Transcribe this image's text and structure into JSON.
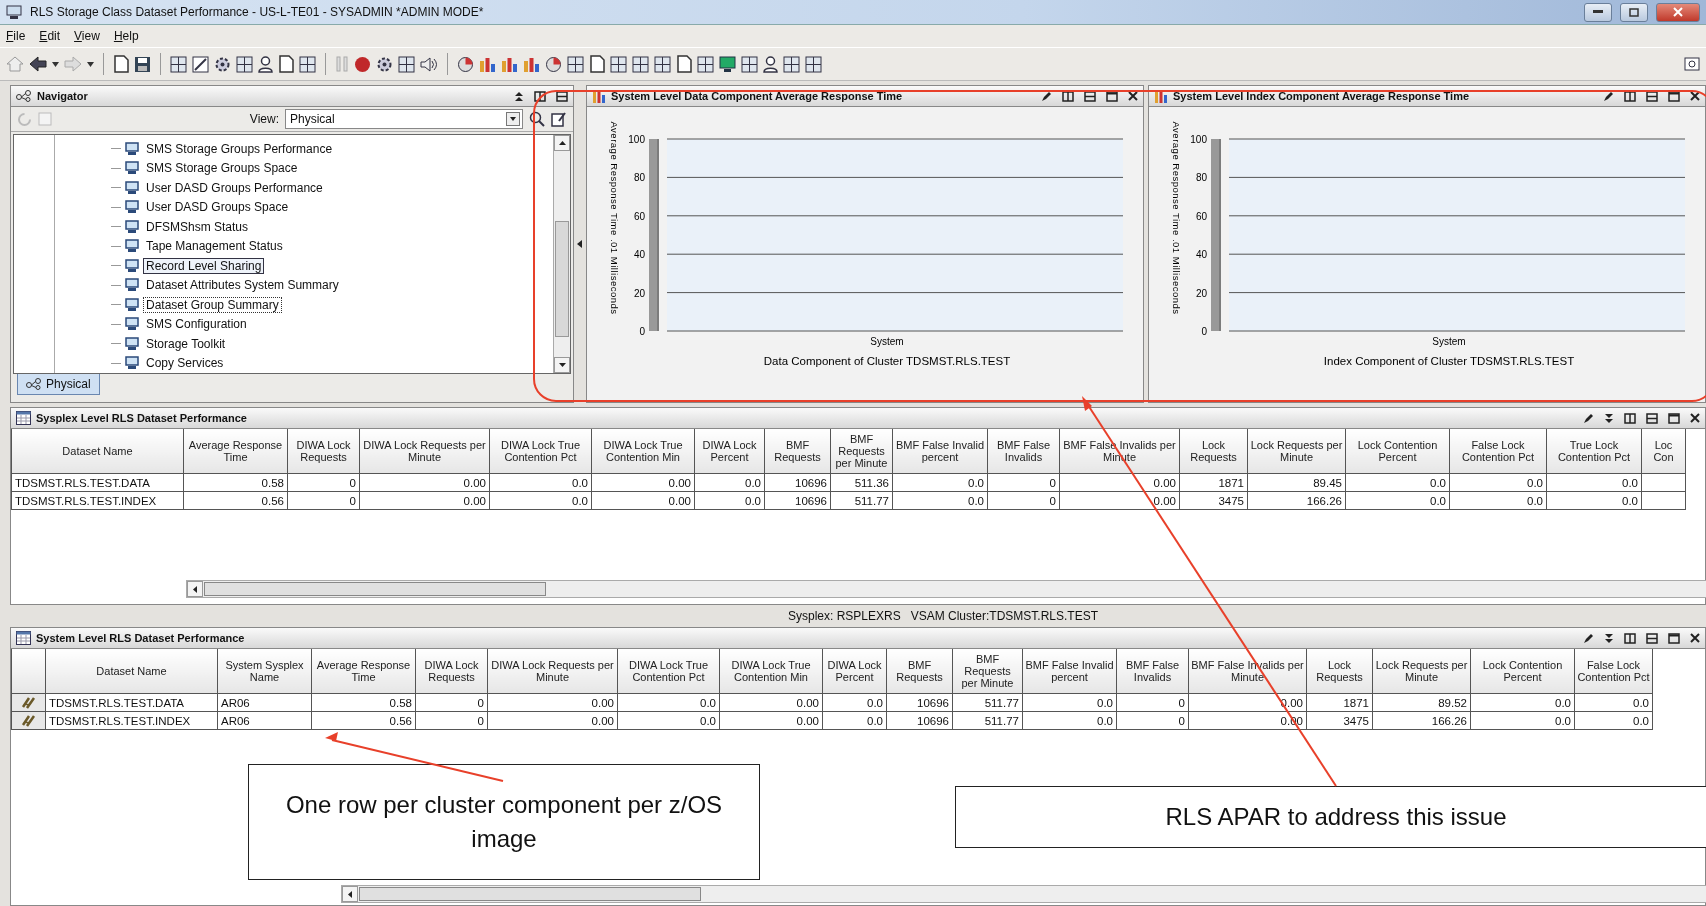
{
  "window": {
    "title": "RLS Storage Class Dataset Performance - US-L-TE01 - SYSADMIN   *ADMIN MODE*"
  },
  "menu": [
    "File",
    "Edit",
    "View",
    "Help"
  ],
  "navigator": {
    "title": "Navigator",
    "view_label": "View:",
    "view_value": "Physical",
    "items": [
      {
        "label": "SMS Storage Groups Performance",
        "selected": false,
        "focused": false
      },
      {
        "label": "SMS Storage Groups Space",
        "selected": false,
        "focused": false
      },
      {
        "label": "User DASD Groups Performance",
        "selected": false,
        "focused": false
      },
      {
        "label": "User DASD Groups Space",
        "selected": false,
        "focused": false
      },
      {
        "label": "DFSMShsm Status",
        "selected": false,
        "focused": false
      },
      {
        "label": "Tape Management Status",
        "selected": false,
        "focused": false
      },
      {
        "label": "Record Level Sharing",
        "selected": true,
        "focused": false
      },
      {
        "label": "Dataset Attributes System Summary",
        "selected": false,
        "focused": false
      },
      {
        "label": "Dataset Group Summary",
        "selected": false,
        "focused": true
      },
      {
        "label": "SMS Configuration",
        "selected": false,
        "focused": false
      },
      {
        "label": "Storage Toolkit",
        "selected": false,
        "focused": false
      },
      {
        "label": "Copy Services",
        "selected": false,
        "focused": false
      }
    ],
    "tabs": [
      {
        "label": "Physical",
        "selected": true
      }
    ]
  },
  "charts": [
    {
      "title": "System Level Data Component Average Response Time",
      "chart_data": {
        "type": "bar",
        "title": "Data Component of Cluster TDSMST.RLS.TEST",
        "ylabel": "Average Response Time .01 Milliseconds",
        "categories": [
          "System"
        ],
        "values": [
          null
        ],
        "ylim": [
          0,
          100
        ],
        "yticks": [
          0,
          20,
          40,
          60,
          80,
          100
        ],
        "grid": true
      }
    },
    {
      "title": "System Level Index Component Average Response Time",
      "chart_data": {
        "type": "bar",
        "title": "Index Component of Cluster TDSMST.RLS.TEST",
        "ylabel": "Average Response Time .01 Milliseconds",
        "categories": [
          "System"
        ],
        "values": [
          null
        ],
        "ylim": [
          0,
          100
        ],
        "yticks": [
          0,
          20,
          40,
          60,
          80,
          100
        ],
        "grid": true
      }
    }
  ],
  "sysplex_table": {
    "title": "Sysplex Level RLS Dataset Performance",
    "columns": [
      "Dataset Name",
      "Average Response Time",
      "DIWA Lock Requests",
      "DIWA Lock Requests per Minute",
      "DIWA Lock True Contention Pct",
      "DIWA Lock True Contention Min",
      "DIWA Lock Percent",
      "BMF Requests",
      "BMF Requests per Minute",
      "BMF False Invalid percent",
      "BMF False Invalids",
      "BMF False Invalids per Minute",
      "Lock Requests",
      "Lock Requests per Minute",
      "Lock Contention Percent",
      "False Lock Contention Pct",
      "True Lock Contention Pct",
      "Loc Con"
    ],
    "rows": [
      [
        "TDSMST.RLS.TEST.DATA",
        "0.58",
        "0",
        "0.00",
        "0.0",
        "0.00",
        "0.0",
        "10696",
        "511.36",
        "0.0",
        "0",
        "0.00",
        "1871",
        "89.45",
        "0.0",
        "0.0",
        "0.0"
      ],
      [
        "TDSMST.RLS.TEST.INDEX",
        "0.56",
        "0",
        "0.00",
        "0.0",
        "0.00",
        "0.0",
        "10696",
        "511.77",
        "0.0",
        "0",
        "0.00",
        "3475",
        "166.26",
        "0.0",
        "0.0",
        "0.0"
      ]
    ]
  },
  "status": {
    "sysplex": "Sysplex: RSPLEXRS",
    "cluster": "VSAM Cluster:TDSMST.RLS.TEST"
  },
  "system_table": {
    "title": "System Level RLS Dataset Performance",
    "columns": [
      "Dataset Name",
      "System Sysplex Name",
      "Average Response Time",
      "DIWA Lock Requests",
      "DIWA Lock Requests per Minute",
      "DIWA Lock True Contention Pct",
      "DIWA Lock True Contention Min",
      "DIWA Lock Percent",
      "BMF Requests",
      "BMF Requests per Minute",
      "BMF False Invalid percent",
      "BMF False Invalids",
      "BMF False Invalids per Minute",
      "Lock Requests",
      "Lock Requests per Minute",
      "Lock Contention Percent",
      "False Lock Contention Pct"
    ],
    "rows": [
      [
        "TDSMST.RLS.TEST.DATA",
        "AR06",
        "0.58",
        "0",
        "0.00",
        "0.0",
        "0.00",
        "0.0",
        "10696",
        "511.77",
        "0.0",
        "0",
        "0.00",
        "1871",
        "89.52",
        "0.0",
        "0.0"
      ],
      [
        "TDSMST.RLS.TEST.INDEX",
        "AR06",
        "0.56",
        "0",
        "0.00",
        "0.0",
        "0.00",
        "0.0",
        "10696",
        "511.77",
        "0.0",
        "0",
        "0.00",
        "3475",
        "166.26",
        "0.0",
        "0.0"
      ]
    ]
  },
  "callouts": [
    "One row per cluster component per z/OS image",
    "RLS APAR to address this issue"
  ]
}
